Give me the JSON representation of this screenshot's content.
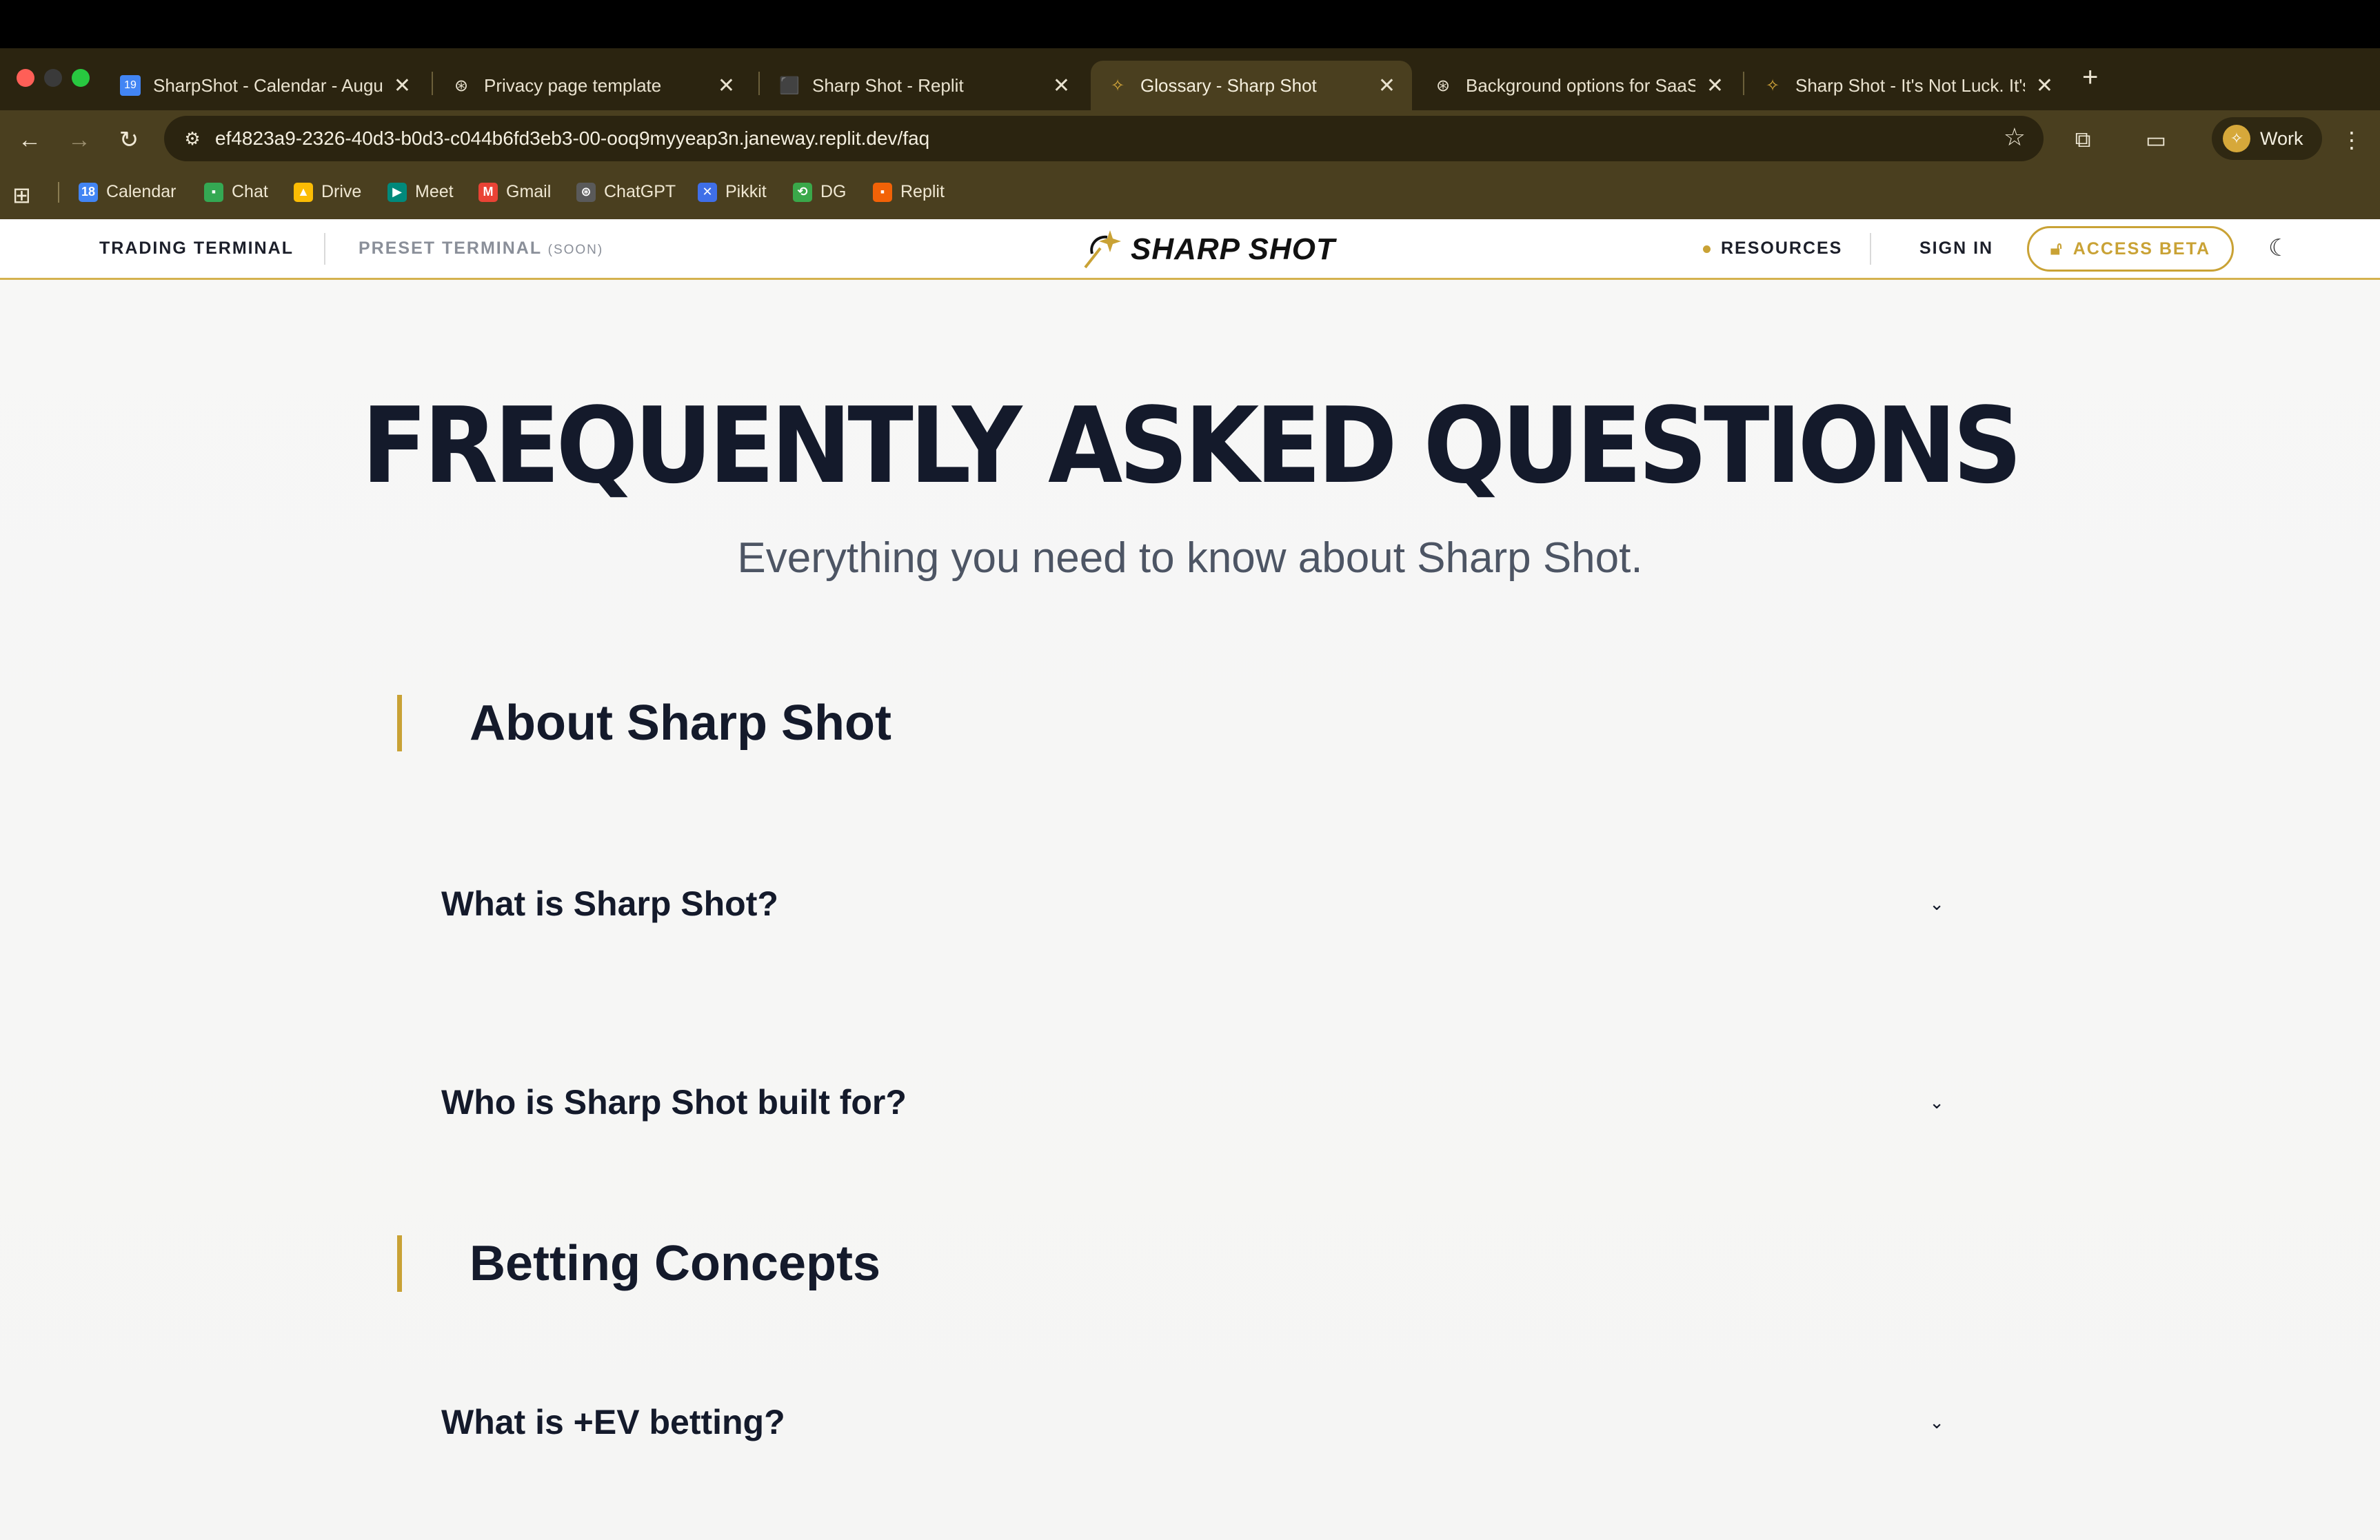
{
  "browser": {
    "tabs": [
      {
        "title": "SharpShot - Calendar - Augu",
        "icon": "calendar-icon"
      },
      {
        "title": "Privacy page template",
        "icon": "chatgpt-icon"
      },
      {
        "title": "Sharp Shot - Replit",
        "icon": "replit-icon"
      },
      {
        "title": "Glossary - Sharp Shot",
        "icon": "sharpshot-icon",
        "active": true
      },
      {
        "title": "Background options for SaaS",
        "icon": "chatgpt-icon"
      },
      {
        "title": "Sharp Shot - It's Not Luck. It's",
        "icon": "sharpshot-icon"
      }
    ],
    "close_glyph": "✕",
    "new_tab_glyph": "+",
    "url": "ef4823a9-2326-40d3-b0d3-c044b6fd3eb3-00-ooq9myyeap3n.janeway.replit.dev/faq",
    "profile_label": "Work",
    "bookmarks": [
      {
        "label": "Calendar",
        "icon": "calendar-icon",
        "color": "#4285f4"
      },
      {
        "label": "Chat",
        "icon": "chat-icon",
        "color": "#34a853"
      },
      {
        "label": "Drive",
        "icon": "drive-icon",
        "color": "#fbbc04"
      },
      {
        "label": "Meet",
        "icon": "meet-icon",
        "color": "#00897b"
      },
      {
        "label": "Gmail",
        "icon": "gmail-icon",
        "color": "#ea4335"
      },
      {
        "label": "ChatGPT",
        "icon": "chatgpt-icon",
        "color": "#5a5a5a"
      },
      {
        "label": "Pikkit",
        "icon": "pikkit-icon",
        "color": "#3f6fe8"
      },
      {
        "label": "DG",
        "icon": "dg-icon",
        "color": "#3aa84a"
      },
      {
        "label": "Replit",
        "icon": "replit-icon",
        "color": "#f26207"
      }
    ]
  },
  "site": {
    "nav": {
      "trading_terminal": "TRADING TERMINAL",
      "preset_terminal": "PRESET TERMINAL",
      "preset_soon": "(SOON)",
      "logo_text": "SHARP SHOT",
      "resources": "RESOURCES",
      "sign_in": "SIGN IN",
      "access_beta": "ACCESS BETA"
    },
    "hero": {
      "title": "FREQUENTLY ASKED QUESTIONS",
      "subtitle": "Everything you need to know about Sharp Shot."
    },
    "sections": [
      {
        "heading": "About Sharp Shot",
        "questions": [
          "What is Sharp Shot?",
          "Who is Sharp Shot built for?"
        ]
      },
      {
        "heading": "Betting Concepts",
        "questions": [
          "What is +EV betting?"
        ]
      }
    ],
    "accent_color": "#c9a235",
    "text_color": "#141a2b"
  }
}
